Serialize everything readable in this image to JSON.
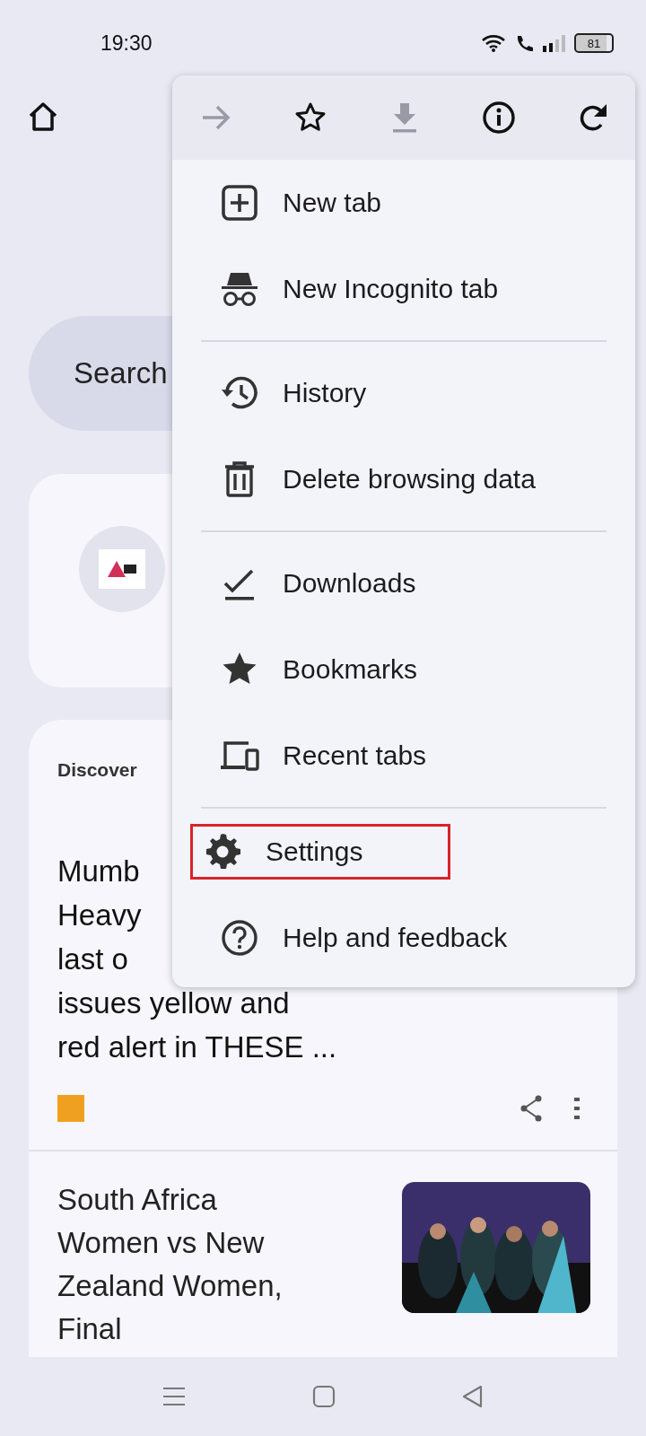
{
  "status_bar": {
    "time": "19:30",
    "battery": "81"
  },
  "search": {
    "placeholder": "Search"
  },
  "discover": {
    "heading": "Discover",
    "article": {
      "lines": [
        "Mumb",
        "Heavy",
        "last o",
        "issues yellow and",
        "red alert in THESE ..."
      ]
    }
  },
  "article_2": {
    "title": "South Africa Women vs New Zealand Women, Final"
  },
  "menu": {
    "toolbar": [
      {
        "disabled": true
      },
      {
        "disabled": false
      },
      {
        "disabled": true
      },
      {
        "disabled": false
      },
      {
        "disabled": false
      }
    ],
    "groups": [
      [
        {
          "label": "New tab",
          "highlighted": false
        },
        {
          "label": "New Incognito tab",
          "highlighted": false
        }
      ],
      [
        {
          "label": "History",
          "highlighted": false
        },
        {
          "label": "Delete browsing data",
          "highlighted": false
        }
      ],
      [
        {
          "label": "Downloads",
          "highlighted": false
        },
        {
          "label": "Bookmarks",
          "highlighted": false
        },
        {
          "label": "Recent tabs",
          "highlighted": false
        }
      ],
      [
        {
          "label": "Settings",
          "highlighted": true
        },
        {
          "label": "Help and feedback",
          "highlighted": false
        }
      ]
    ]
  }
}
